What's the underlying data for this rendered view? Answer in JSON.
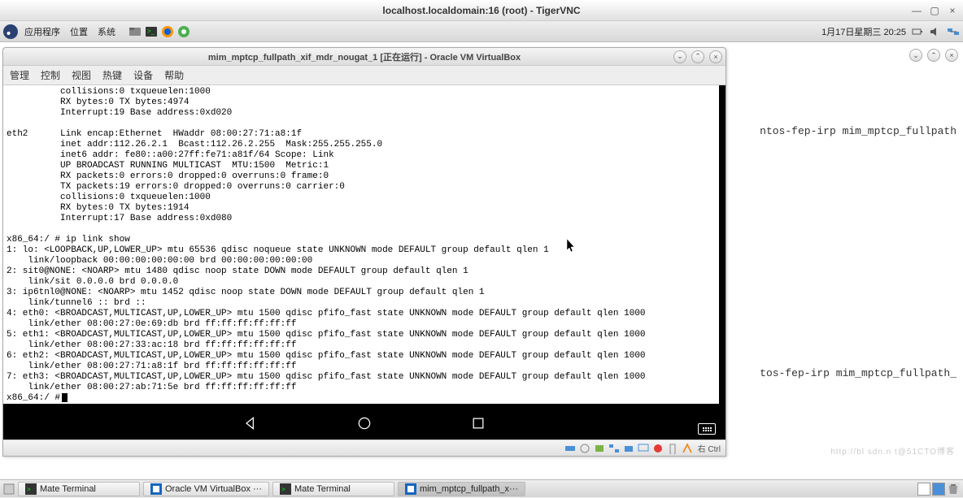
{
  "outer_window": {
    "title": "localhost.localdomain:16 (root) - TigerVNC"
  },
  "panel": {
    "apps": "应用程序",
    "places": "位置",
    "system": "系统",
    "datetime": "1月17日星期三 20:25"
  },
  "outer_round_btns": {
    "minimize": "⌄",
    "maximize": "⌃",
    "close": "×"
  },
  "vbox": {
    "title": "mim_mptcp_fullpath_xif_mdr_nougat_1 [正在运行] - Oracle VM VirtualBox",
    "menu": {
      "m1": "管理",
      "m2": "控制",
      "m3": "视图",
      "m4": "热键",
      "m5": "设备",
      "m6": "帮助"
    },
    "statusbar_host": "右 Ctrl"
  },
  "terminal_text": "          collisions:0 txqueuelen:1000\n          RX bytes:0 TX bytes:4974\n          Interrupt:19 Base address:0xd020\n\neth2      Link encap:Ethernet  HWaddr 08:00:27:71:a8:1f\n          inet addr:112.26.2.1  Bcast:112.26.2.255  Mask:255.255.255.0\n          inet6 addr: fe80::a00:27ff:fe71:a81f/64 Scope: Link\n          UP BROADCAST RUNNING MULTICAST  MTU:1500  Metric:1\n          RX packets:0 errors:0 dropped:0 overruns:0 frame:0\n          TX packets:19 errors:0 dropped:0 overruns:0 carrier:0\n          collisions:0 txqueuelen:1000\n          RX bytes:0 TX bytes:1914\n          Interrupt:17 Base address:0xd080\n\nx86_64:/ # ip link show\n1: lo: <LOOPBACK,UP,LOWER_UP> mtu 65536 qdisc noqueue state UNKNOWN mode DEFAULT group default qlen 1\n    link/loopback 00:00:00:00:00:00 brd 00:00:00:00:00:00\n2: sit0@NONE: <NOARP> mtu 1480 qdisc noop state DOWN mode DEFAULT group default qlen 1\n    link/sit 0.0.0.0 brd 0.0.0.0\n3: ip6tnl0@NONE: <NOARP> mtu 1452 qdisc noop state DOWN mode DEFAULT group default qlen 1\n    link/tunnel6 :: brd ::\n4: eth0: <BROADCAST,MULTICAST,UP,LOWER_UP> mtu 1500 qdisc pfifo_fast state UNKNOWN mode DEFAULT group default qlen 1000\n    link/ether 08:00:27:0e:69:db brd ff:ff:ff:ff:ff:ff\n5: eth1: <BROADCAST,MULTICAST,UP,LOWER_UP> mtu 1500 qdisc pfifo_fast state UNKNOWN mode DEFAULT group default qlen 1000\n    link/ether 08:00:27:33:ac:18 brd ff:ff:ff:ff:ff:ff\n6: eth2: <BROADCAST,MULTICAST,UP,LOWER_UP> mtu 1500 qdisc pfifo_fast state UNKNOWN mode DEFAULT group default qlen 1000\n    link/ether 08:00:27:71:a8:1f brd ff:ff:ff:ff:ff:ff\n7: eth3: <BROADCAST,MULTICAST,UP,LOWER_UP> mtu 1500 qdisc pfifo_fast state UNKNOWN mode DEFAULT group default qlen 1000\n    link/ether 08:00:27:ab:71:5e brd ff:ff:ff:ff:ff:ff\nx86_64:/ # ",
  "bg_text_1": "ntos-fep-irp mim_mptcp_fullpath",
  "bg_text_2": "tos-fep-irp mim_mptcp_fullpath_",
  "taskbar": {
    "items": [
      {
        "label": "Mate Terminal",
        "icon": "terminal"
      },
      {
        "label": "Oracle VM VirtualBox ···",
        "icon": "vbox"
      },
      {
        "label": "Mate Terminal",
        "icon": "terminal"
      },
      {
        "label": "mim_mptcp_fullpath_x···",
        "icon": "vbox"
      }
    ]
  },
  "watermark": "http://bl  sdn.n  t@51CTO博客"
}
